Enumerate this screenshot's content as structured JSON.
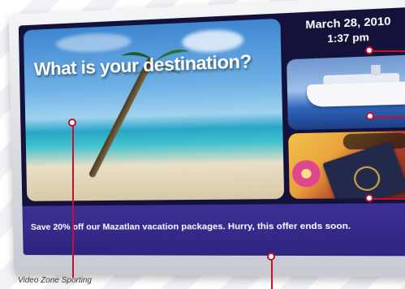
{
  "screen": {
    "headline": "What is your destination?",
    "date": "March 28, 2010",
    "time": "1:37 pm",
    "ticker": "Save 20% off our Mazatlan vacation packages. Hurry, this offer ends soon."
  },
  "caption": {
    "text": "Video Zone Sporting"
  },
  "colors": {
    "screen_bg": "#14123a",
    "ticker_bg": "#2d2481",
    "callout": "#c8102e",
    "headline": "#ffffff"
  },
  "icons": [
    "palm-tree",
    "cruise-ship",
    "passport",
    "hibiscus-flower",
    "sunglasses"
  ]
}
